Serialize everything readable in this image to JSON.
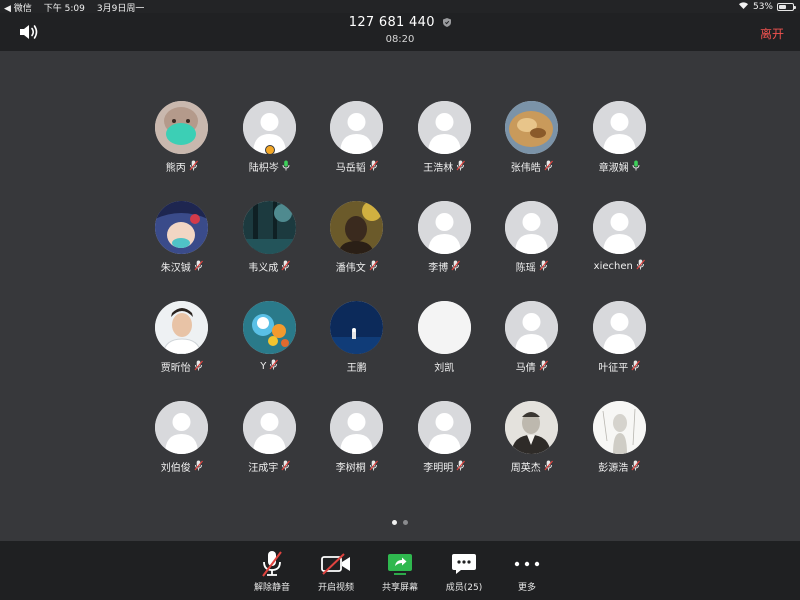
{
  "status_bar": {
    "back_app": "◀ 微信",
    "time": "下午 5:09",
    "date": "3月9日周一",
    "battery": "53%",
    "battery_level": 0.53
  },
  "header": {
    "meeting_id": "127 681 440",
    "duration": "08:20",
    "leave_label": "离开"
  },
  "participants": [
    {
      "name": "熊丙",
      "mic": "muted",
      "avatar": "photo-mint-mask"
    },
    {
      "name": "陆枳岑",
      "mic": "on",
      "avatar": "default",
      "speaking": true
    },
    {
      "name": "马岳韬",
      "mic": "muted",
      "avatar": "default"
    },
    {
      "name": "王浩林",
      "mic": "muted",
      "avatar": "default"
    },
    {
      "name": "张伟皓",
      "mic": "muted",
      "avatar": "photo-food"
    },
    {
      "name": "章淑娴",
      "mic": "on",
      "avatar": "default"
    },
    {
      "name": "朱汉铖",
      "mic": "muted",
      "avatar": "photo-anime"
    },
    {
      "name": "韦义成",
      "mic": "muted",
      "avatar": "photo-trees"
    },
    {
      "name": "潘伟文",
      "mic": "muted",
      "avatar": "photo-portrait-dark"
    },
    {
      "name": "李博",
      "mic": "muted",
      "avatar": "default"
    },
    {
      "name": "陈瑶",
      "mic": "muted",
      "avatar": "default"
    },
    {
      "name": "xiechen",
      "mic": "muted",
      "avatar": "default"
    },
    {
      "name": "贾昕怡",
      "mic": "muted",
      "avatar": "photo-man-light"
    },
    {
      "name": "Y",
      "mic": "muted",
      "avatar": "photo-cartoon"
    },
    {
      "name": "王鹏",
      "mic": "none",
      "avatar": "photo-blue-night"
    },
    {
      "name": "刘凯",
      "mic": "none",
      "avatar": "blank-white"
    },
    {
      "name": "马倩",
      "mic": "muted",
      "avatar": "default"
    },
    {
      "name": "叶征平",
      "mic": "muted",
      "avatar": "default"
    },
    {
      "name": "刘伯俊",
      "mic": "muted",
      "avatar": "default"
    },
    {
      "name": "汪成宇",
      "mic": "muted",
      "avatar": "default"
    },
    {
      "name": "李树桐",
      "mic": "muted",
      "avatar": "default"
    },
    {
      "name": "李明明",
      "mic": "muted",
      "avatar": "default"
    },
    {
      "name": "周英杰",
      "mic": "muted",
      "avatar": "photo-sketch-man"
    },
    {
      "name": "彭源浩",
      "mic": "muted",
      "avatar": "photo-sketch-light"
    }
  ],
  "pagination": {
    "pages": 2,
    "current": 1
  },
  "toolbar": {
    "unmute": "解除静音",
    "start_video": "开启视频",
    "share_screen": "共享屏幕",
    "members": "成员(25)",
    "more": "更多"
  },
  "colors": {
    "accent_leave": "#f0524f",
    "share_green": "#2fb84f",
    "mute_red": "#e0433f",
    "speaking_orange": "#f3a726"
  }
}
